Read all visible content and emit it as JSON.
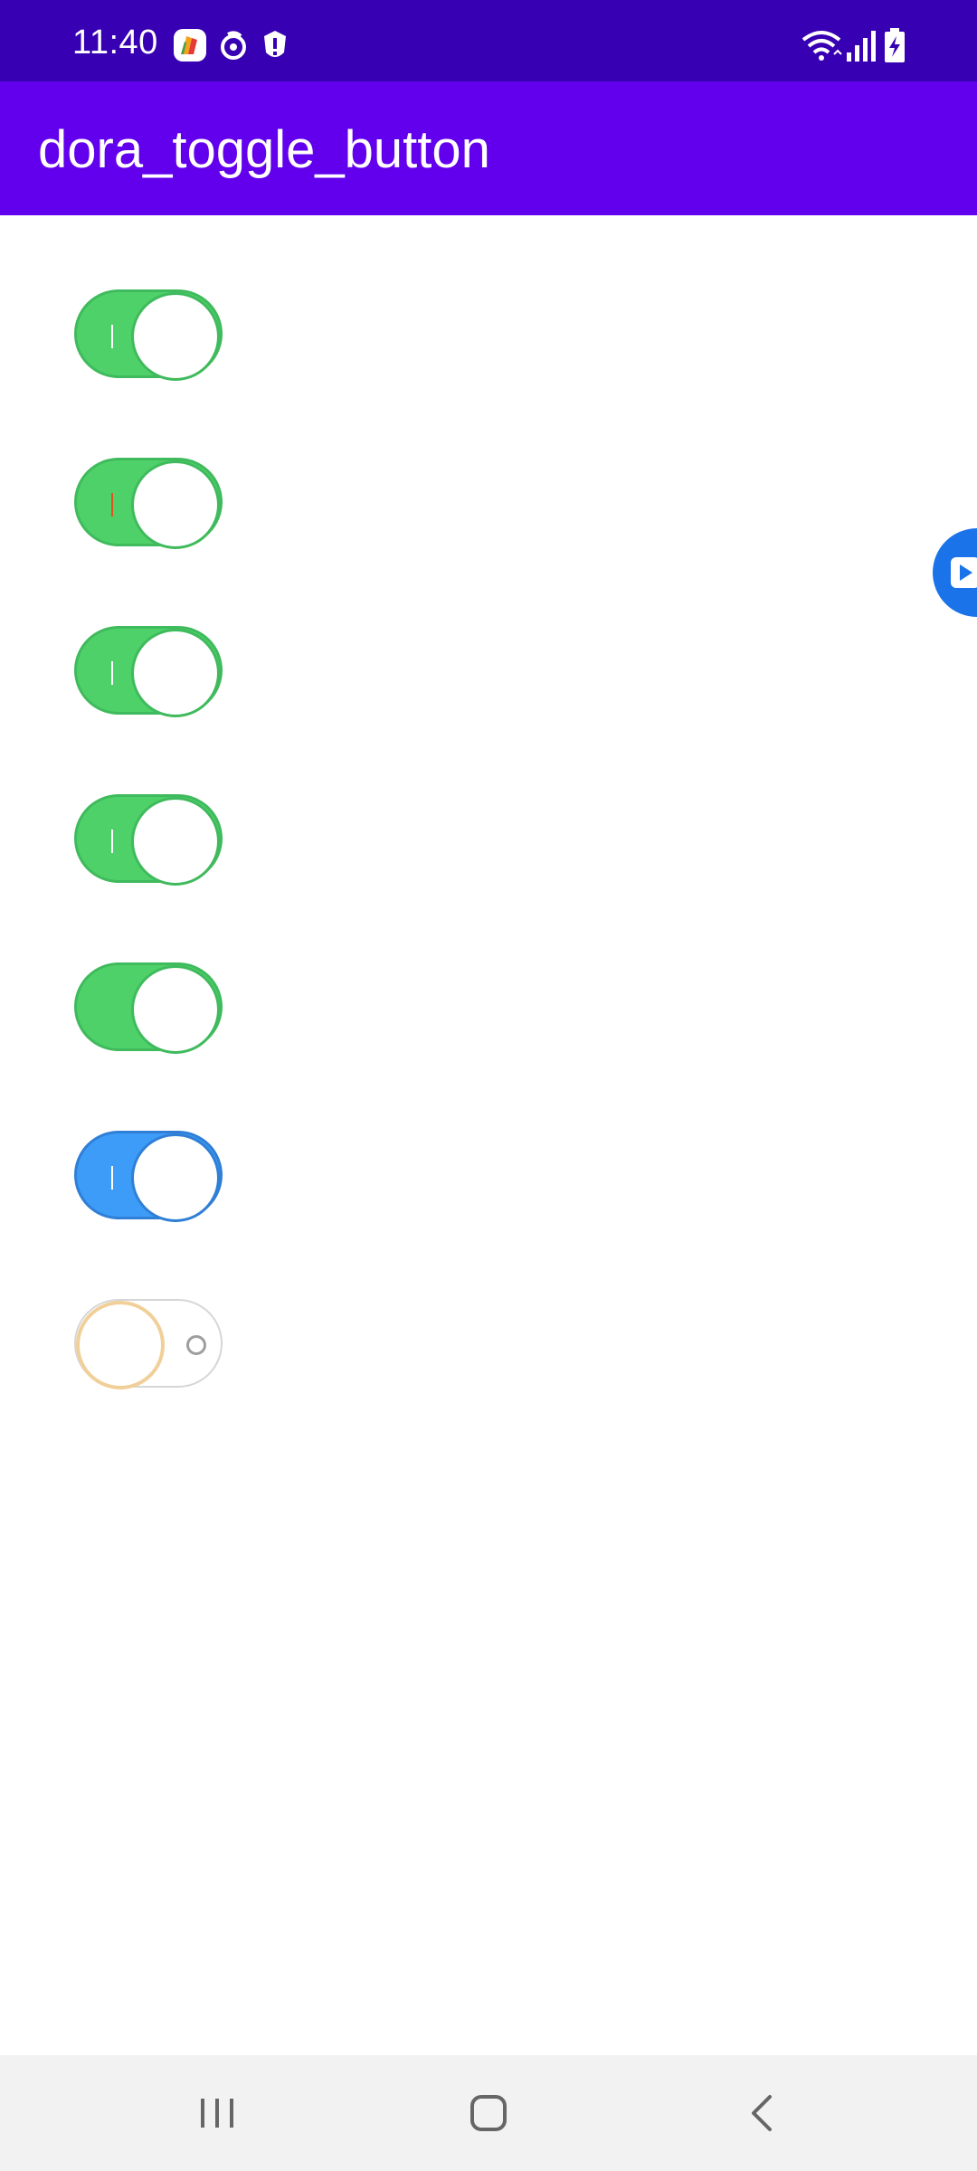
{
  "status_bar": {
    "time": "11:40",
    "background": "#3700b3",
    "left_icons": [
      "app-notification-icon",
      "sync-icon",
      "shield-icon"
    ],
    "right_icons": [
      "wifi-icon",
      "signal-icon",
      "battery-charging-icon"
    ]
  },
  "app_bar": {
    "title": "dora_toggle_button",
    "background": "#6200ee"
  },
  "toggles": [
    {
      "state": "on",
      "track_color": "#4fd16a",
      "border_color": "#3fba5c",
      "on_mark_color": "#ffffff"
    },
    {
      "state": "on",
      "track_color": "#4fd16a",
      "border_color": "#3fba5c",
      "on_mark_color": "#e0521f"
    },
    {
      "state": "on",
      "track_color": "#4fd16a",
      "border_color": "#3fba5c",
      "on_mark_color": "#ffffff"
    },
    {
      "state": "on",
      "track_color": "#4fd16a",
      "border_color": "#3fba5c",
      "on_mark_color": "#ffffff"
    },
    {
      "state": "on",
      "track_color": "#4fd16a",
      "border_color": "#3fba5c",
      "on_mark_color": ""
    },
    {
      "state": "on",
      "track_color": "#3d9cf7",
      "border_color": "#2f7fd6",
      "on_mark_color": "#ffffff"
    },
    {
      "state": "off",
      "track_color": "#ffffff",
      "border_color": "#d6d6d6",
      "knob_border_color": "#f1cf98",
      "off_mark_color": "#9e9e9e"
    }
  ],
  "floating_button": {
    "icon": "play-icon",
    "color": "#1a73e8"
  },
  "nav_bar": {
    "buttons": [
      "recent-apps-icon",
      "home-icon",
      "back-icon"
    ],
    "background": "#f2f2f2"
  }
}
